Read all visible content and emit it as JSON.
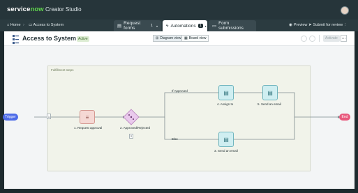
{
  "app": {
    "brand_service": "service",
    "brand_now": "now",
    "studio": "Creator Studio"
  },
  "breadcrumb": {
    "home": "Home",
    "current": "Access to System"
  },
  "tabs": [
    {
      "label": "Request forms",
      "count": "1"
    },
    {
      "label": "Automations",
      "count": "1"
    },
    {
      "label": "Form submissions"
    }
  ],
  "actions": {
    "preview": "Preview",
    "submit": "Submit for review"
  },
  "flow": {
    "title": "Access to System",
    "status": "Active",
    "diagram_view": "Diagram view",
    "board_view": "Board view",
    "activate": "Activate",
    "group_label": "Fulfillment steps",
    "trigger": "Trigger",
    "end": "End",
    "steps": {
      "approval": "1. Request approval",
      "decision": "2. Approved/Rejected",
      "decision_badge": "2",
      "assign": "4. Assign to",
      "email_top": "5. Send an email",
      "email_bottom": "3. Send an email",
      "start_badge": "1"
    },
    "branches": {
      "approved": "If Approved",
      "else": "Else"
    }
  },
  "colors": {
    "trigger": "#4c6be8",
    "end": "#e85a7d",
    "active_badge": "#dcecd2",
    "node_teal": "#cfeef1",
    "node_red": "#f5d8d4",
    "decision": "#e9c9ec"
  }
}
